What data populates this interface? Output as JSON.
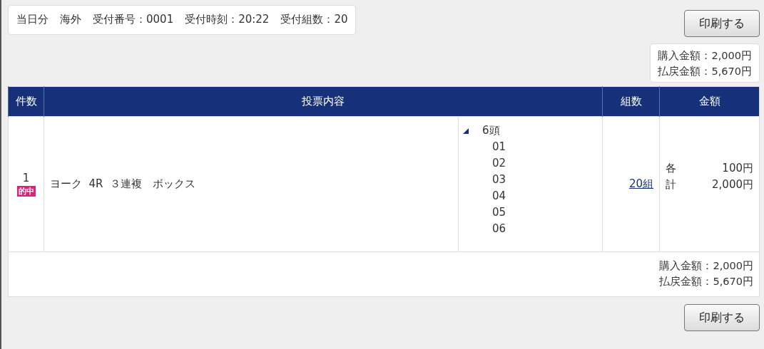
{
  "info": {
    "items": [
      "当日分",
      "海外",
      "受付番号：0001",
      "受付時刻：20:22",
      "受付組数：20"
    ]
  },
  "print_button_top": {
    "label": "印刷する"
  },
  "summary": {
    "lines": [
      "購入金額：2,000円",
      "払戻金額：5,670円"
    ]
  },
  "table": {
    "columns": [
      "件数",
      "投票内容",
      "組数",
      "金額"
    ],
    "rows": [
      {
        "number": "1",
        "badge": "的中",
        "bet": "ヨーク  4R  ３連複　ボックス",
        "horses": {
          "label": "6頭",
          "expanded": true,
          "items": [
            "01",
            "02",
            "03",
            "04",
            "05",
            "06"
          ]
        },
        "combos": "20組",
        "amounts": [
          {
            "label": "各",
            "value": "100円"
          },
          {
            "label": "計",
            "value": "2,000円"
          }
        ]
      }
    ],
    "footer": [
      "購入金額：2,000円",
      "払戻金額：5,670円"
    ]
  },
  "print_button_bottom": {
    "label": "印刷する"
  }
}
